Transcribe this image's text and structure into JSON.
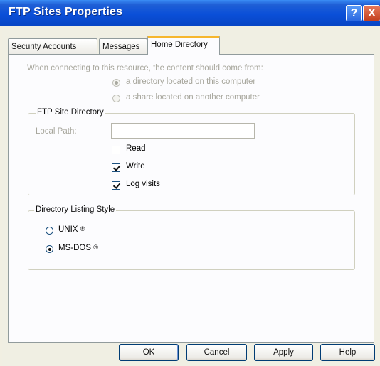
{
  "window": {
    "title": "FTP Sites Properties",
    "help_glyph": "?",
    "close_glyph": "X"
  },
  "tabs": [
    {
      "label": "Security Accounts",
      "active": false
    },
    {
      "label": "Messages",
      "active": false
    },
    {
      "label": "Home Directory",
      "active": true
    }
  ],
  "home_directory": {
    "source_prompt": "When connecting to this resource, the content should come from:",
    "source_options": [
      {
        "label": "a directory located on this computer",
        "selected": true,
        "enabled": false
      },
      {
        "label": "a share located on another computer",
        "selected": false,
        "enabled": false
      }
    ],
    "ftp_site_directory": {
      "legend": "FTP Site Directory",
      "local_path_label": "Local Path:",
      "local_path_value": "",
      "checkboxes": [
        {
          "label": "Read",
          "checked": false
        },
        {
          "label": "Write",
          "checked": true
        },
        {
          "label": "Log visits",
          "checked": true
        }
      ]
    },
    "listing_style": {
      "legend": "Directory Listing Style",
      "options": [
        {
          "label": "UNIX",
          "trademark": "®",
          "selected": false
        },
        {
          "label": "MS-DOS",
          "trademark": "®",
          "selected": true
        }
      ]
    }
  },
  "buttons": {
    "ok": "OK",
    "cancel": "Cancel",
    "apply": "Apply",
    "help": "Help"
  },
  "colors": {
    "titlebar": "#0a4fd8",
    "active_tab_accent": "#f6b62c",
    "dialog_face": "#f0efe3"
  }
}
